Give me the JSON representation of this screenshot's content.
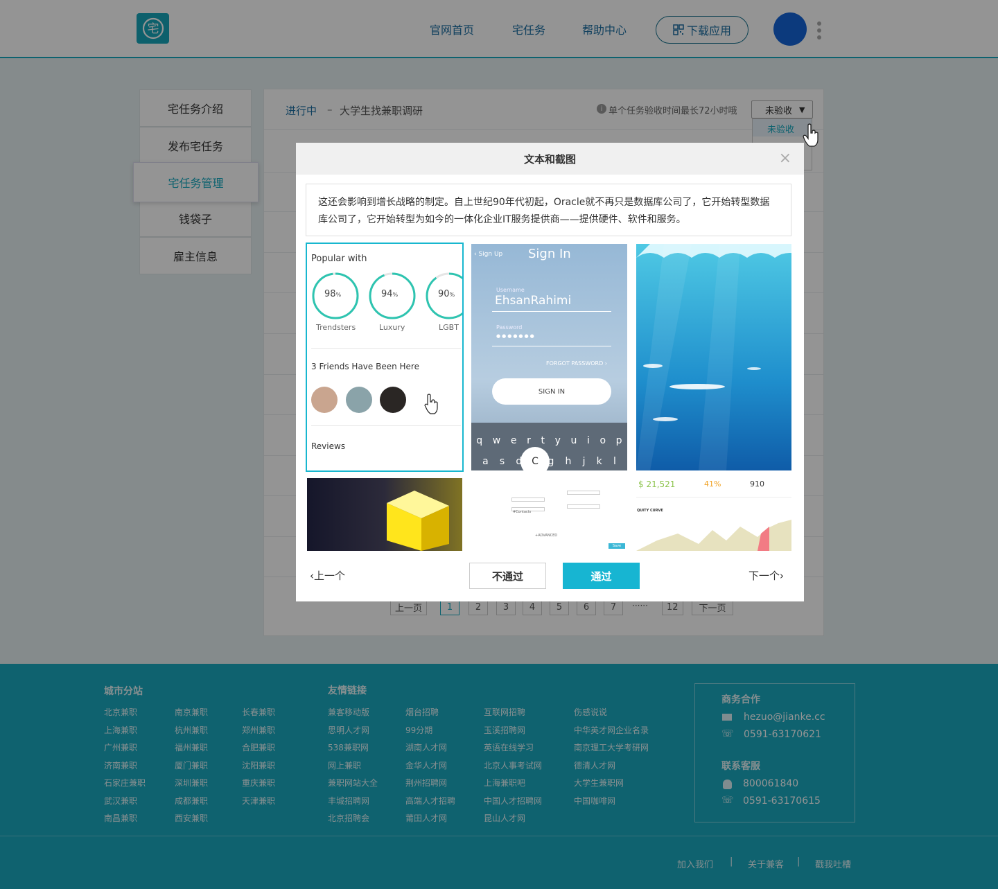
{
  "header": {
    "logo_glyph": "宅",
    "nav": [
      "官网首页",
      "宅任务",
      "帮助中心"
    ],
    "download_label": "下载应用"
  },
  "sidebar": {
    "items": [
      {
        "label": "宅任务介绍"
      },
      {
        "label": "发布宅任务"
      },
      {
        "label": "宅任务管理"
      },
      {
        "label": "钱袋子"
      },
      {
        "label": "雇主信息"
      }
    ]
  },
  "main": {
    "status": "进行中",
    "separator": "–",
    "task_title": "大学生找兼职调研",
    "notice": "单个任务验收时间最长72小时哦",
    "filter_selected": "未验收",
    "filter_options": [
      "未验收"
    ],
    "pagination": {
      "prev": "上一页",
      "pages": [
        "1",
        "2",
        "3",
        "4",
        "5",
        "6",
        "7"
      ],
      "ellipsis": "······",
      "last": "12",
      "next": "下一页",
      "current": "1"
    }
  },
  "modal": {
    "title": "文本和截图",
    "close": "×",
    "text": "这还会影响到增长战略的制定。自上世纪90年代初起，Oracle就不再只是数据库公司了，它开始转型数据库公司了，它开始转型为如今的一体化企业IT服务提供商——提供硬件、软件和服务。",
    "prev": "上一个",
    "next": "下一个",
    "reject": "不通过",
    "approve": "通过",
    "thumb1": {
      "popular": "Popular with",
      "stats": [
        {
          "value": "98",
          "unit": "%",
          "label": "Trendsters",
          "pct": 0.98
        },
        {
          "value": "94",
          "unit": "%",
          "label": "Luxury",
          "pct": 0.94
        },
        {
          "value": "90",
          "unit": "%",
          "label": "LGBT",
          "pct": 0.9
        }
      ],
      "friends": "3 Friends Have Been Here",
      "reviews": "Reviews"
    },
    "thumb2": {
      "back": "‹ Sign Up",
      "title": "Sign In",
      "user_label": "Username",
      "user": "EhsanRahimi",
      "pass_label": "Password",
      "pass": "●●●●●●●",
      "forgot": "FORGOT PASSWORD ›",
      "signin": "SIGN IN",
      "keys1": [
        "q",
        "w",
        "e",
        "r",
        "t",
        "y",
        "u",
        "i",
        "o",
        "p"
      ],
      "keys2": [
        "a",
        "s",
        "d",
        "f",
        "g",
        "h",
        "j",
        "k",
        "l"
      ],
      "key_popup": "C"
    },
    "thumb6": {
      "v1": "$ 21,521",
      "v2": "41%",
      "v3": "910",
      "curve": "QUITY CURVE"
    },
    "thumb5": {
      "advanced": "+ADVANCED",
      "contacts": "#Contacts",
      "save": "Save"
    }
  },
  "footer": {
    "city_title": "城市分站",
    "cities": [
      [
        "北京兼职",
        "上海兼职",
        "广州兼职",
        "济南兼职",
        "石家庄兼职",
        "武汉兼职",
        "南昌兼职"
      ],
      [
        "南京兼职",
        "杭州兼职",
        "福州兼职",
        "厦门兼职",
        "深圳兼职",
        "成都兼职",
        "西安兼职"
      ],
      [
        "长春兼职",
        "郑州兼职",
        "合肥兼职",
        "沈阳兼职",
        "重庆兼职",
        "天津兼职"
      ]
    ],
    "links_title": "友情链接",
    "links": [
      [
        "兼客移动版",
        "思明人才网",
        "538兼职网",
        "网上兼职",
        "兼职网站大全",
        "丰城招聘网",
        "北京招聘会"
      ],
      [
        "烟台招聘",
        "99分期",
        "湖南人才网",
        "金华人才网",
        "荆州招聘网",
        "高端人才招聘",
        "莆田人才网"
      ],
      [
        "互联网招聘",
        "玉溪招聘网",
        "英语在线学习",
        "北京人事考试网",
        "上海兼职吧",
        "中国人才招聘网",
        "昆山人才网"
      ],
      [
        "伤感说说",
        "中华英才网企业名录",
        "南京理工大学考研网",
        "德清人才网",
        "大学生兼职网",
        "中国咖啡网"
      ]
    ],
    "biz_title": "商务合作",
    "email": "hezuo@jianke.cc",
    "biz_phone": "0591-63170621",
    "support_title": "联系客服",
    "qq": "800061840",
    "support_phone": "0591-63170615",
    "bottom_links": [
      "加入我们",
      "关于兼客",
      "戳我吐槽"
    ],
    "sep": "|"
  }
}
